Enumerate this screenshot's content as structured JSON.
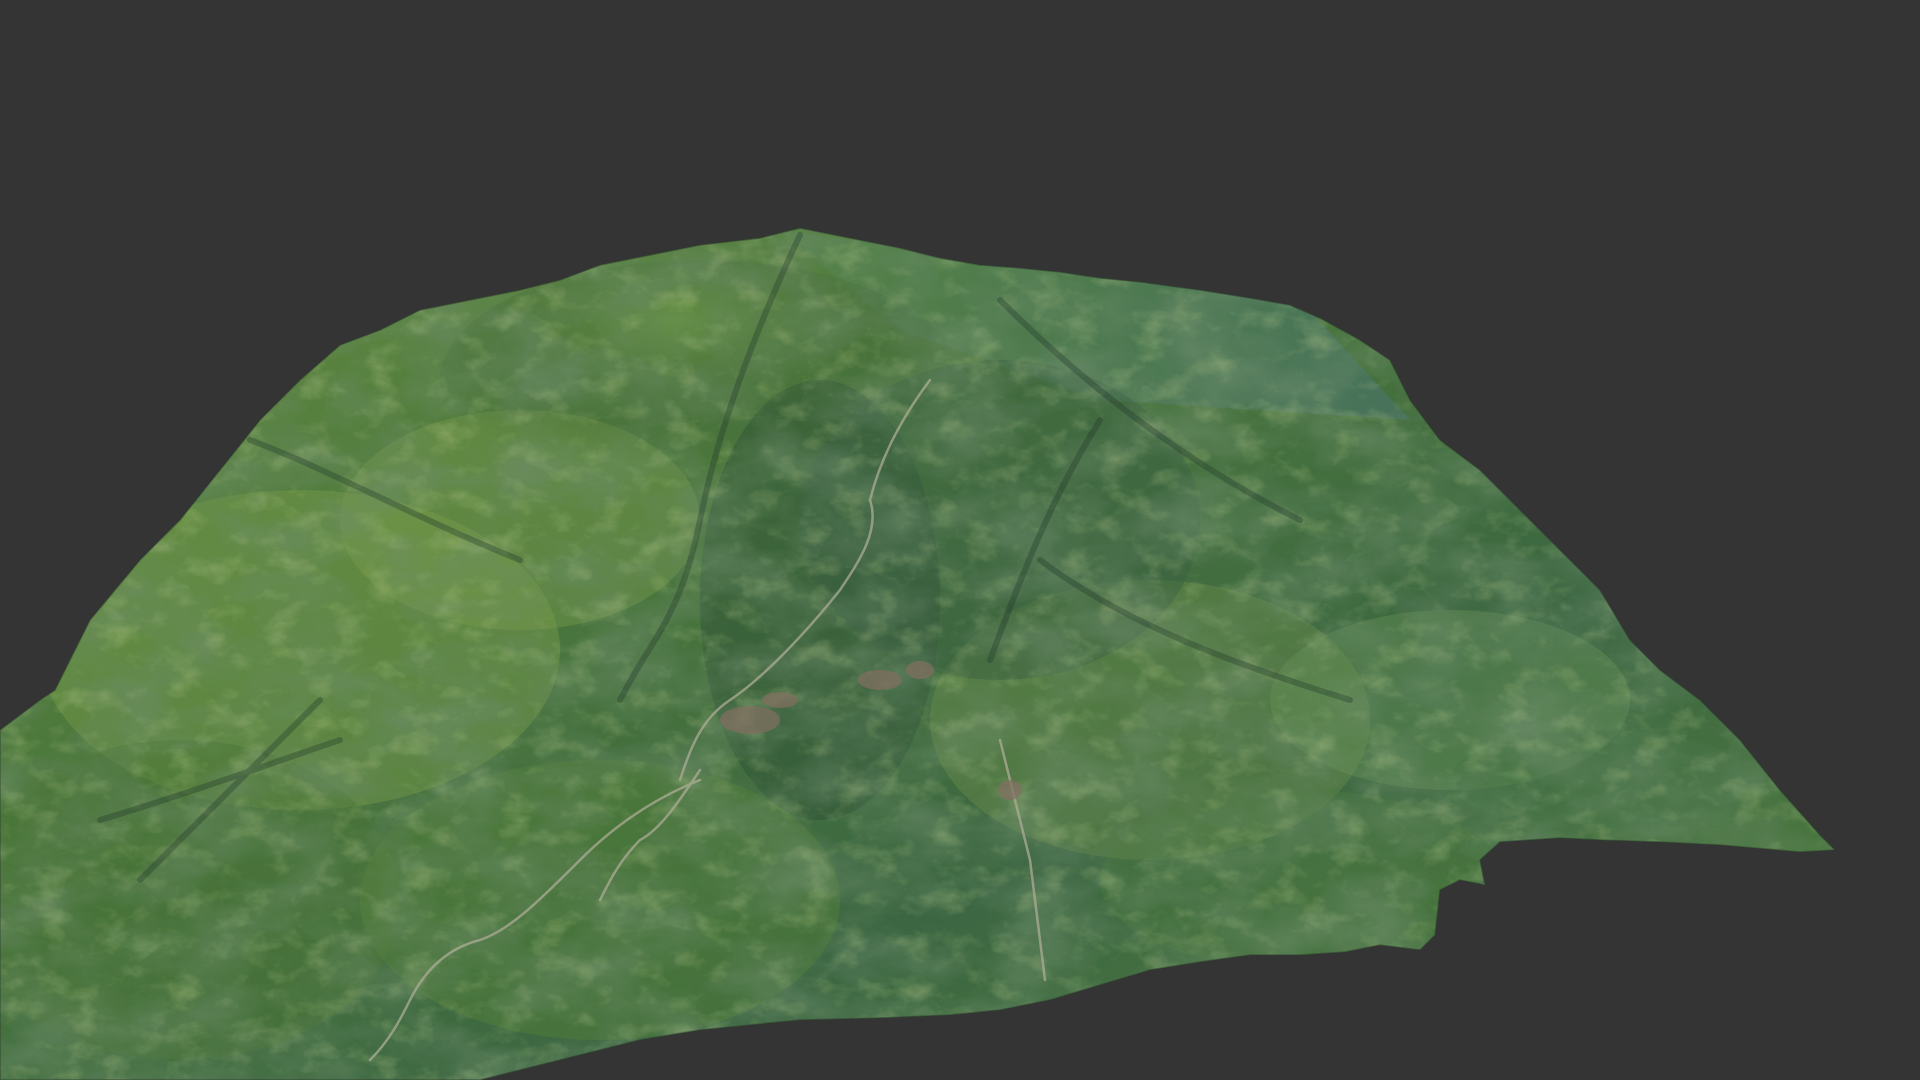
{
  "scene": {
    "subject": "textured-3d-terrain-mesh",
    "colors": {
      "background": "#343434",
      "terrain_dark": "#2f4a2e",
      "terrain_mid": "#4f7a3c",
      "terrain_light": "#7fa04a",
      "terrain_blue": "#3e6b63",
      "terrain_brown": "#7a6a45",
      "road": "#b9b7a0",
      "settlement": "#8c7466"
    }
  }
}
